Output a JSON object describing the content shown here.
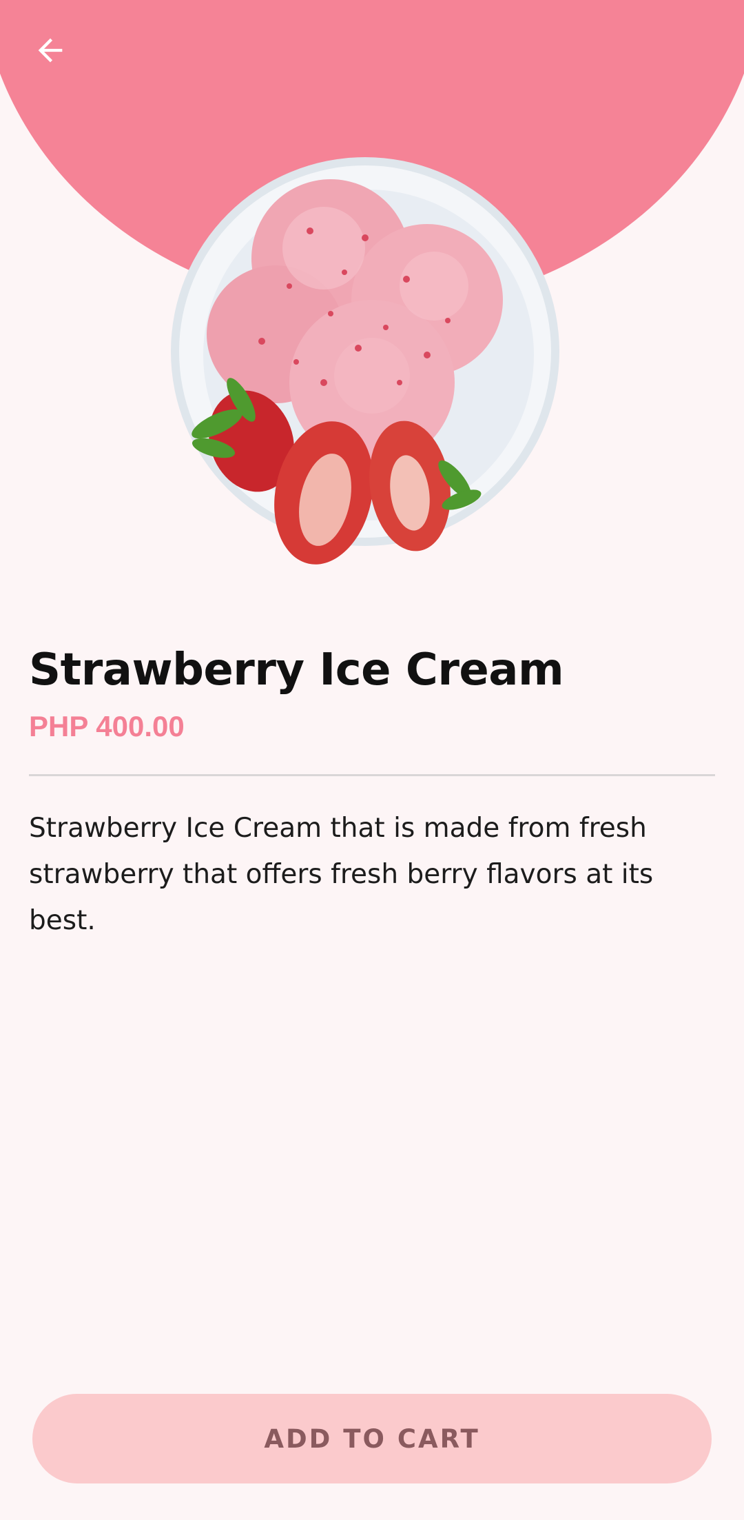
{
  "header": {
    "back_icon": "arrow-left-icon",
    "background_color": "#f58396"
  },
  "product": {
    "image_alt": "strawberry-ice-cream-bowl",
    "title": "Strawberry Ice Cream",
    "price": "PHP 400.00",
    "description": "Strawberry Ice Cream that is made from fresh strawberry that offers fresh berry flavors at its best."
  },
  "actions": {
    "add_to_cart_label": "ADD TO CART"
  },
  "colors": {
    "page_background": "#fdf5f6",
    "accent": "#f48095",
    "button_background": "#fbcacc",
    "button_text": "#8a5a5e"
  }
}
